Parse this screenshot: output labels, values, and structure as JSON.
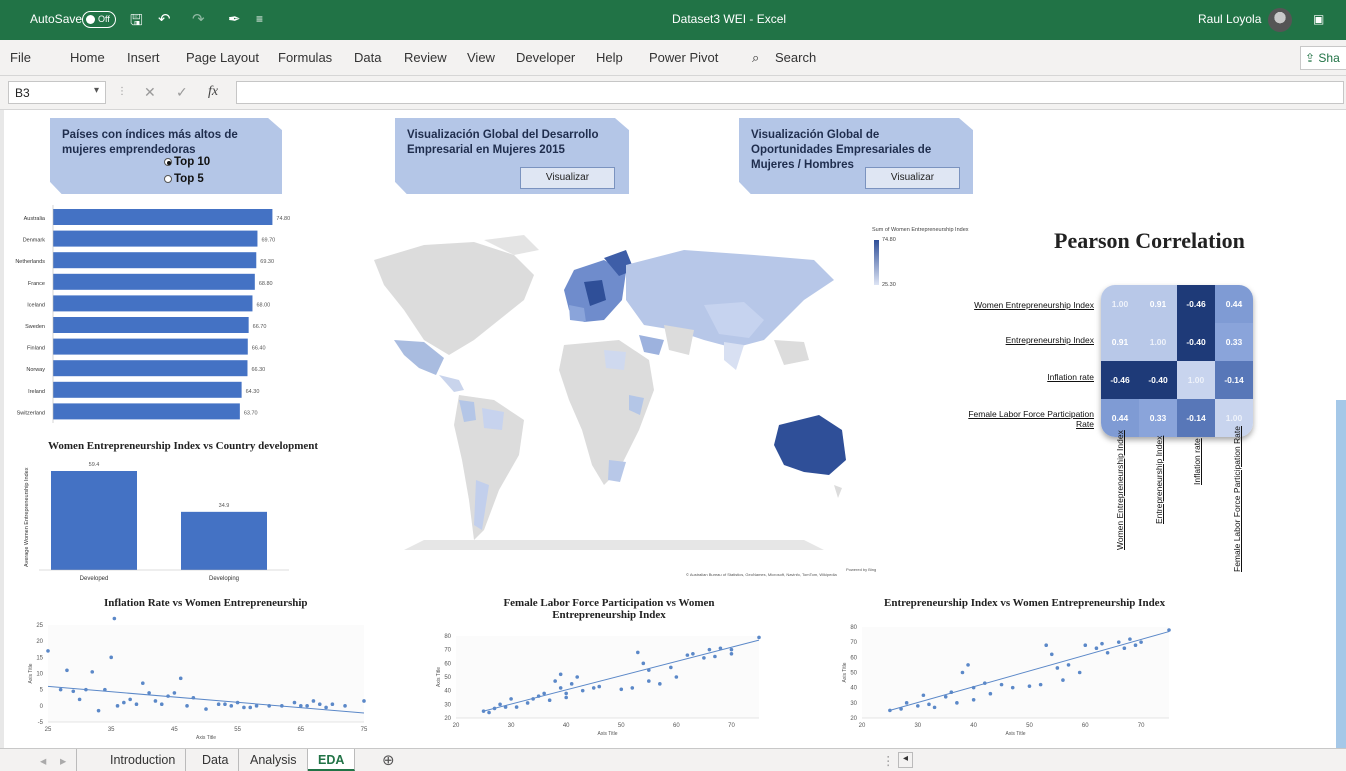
{
  "window": {
    "autosave_label": "AutoSave",
    "autosave_state": "Off",
    "title": "Dataset3 WEI  -  Excel",
    "user": "Raul Loyola"
  },
  "ribbon": {
    "tabs": [
      "File",
      "Home",
      "Insert",
      "Page Layout",
      "Formulas",
      "Data",
      "Review",
      "View",
      "Developer",
      "Help",
      "Power Pivot"
    ],
    "search": "Search",
    "share": "Sha"
  },
  "formula_bar": {
    "name_box": "B3",
    "fx": "fx",
    "formula": ""
  },
  "panels": {
    "top_countries_title": "Países con índices más altos de mujeres emprendedoras",
    "radio_top10": "Top 10",
    "radio_top5": "Top 5",
    "global_dev_title": "Visualización Global del Desarrollo Empresarial en Mujeres 2015",
    "global_opp_title": "Visualización Global de Oportunidades Empresariales de Mujeres / Hombres",
    "visualize_btn": "Visualizar"
  },
  "map": {
    "legend_title": "Sum of Women Entrepreneurship Index",
    "legend_max": "74.80",
    "legend_min": "25.30",
    "powered_by": "Powered by Bing",
    "credits": "© Australian Bureau of Statistics, GeoNames, Microsoft, Navinfo, TomTom, Wikipedia"
  },
  "correlation": {
    "title": "Pearson Correlation",
    "labels": [
      "Women Entrepreneurship Index",
      "Entrepreneurship Index",
      "Inflation rate",
      "Female Labor Force Participation Rate"
    ],
    "matrix": [
      [
        "1.00",
        "0.91",
        "-0.46",
        "0.44"
      ],
      [
        "0.91",
        "1.00",
        "-0.40",
        "0.33"
      ],
      [
        "-0.46",
        "-0.40",
        "1.00",
        "-0.14"
      ],
      [
        "0.44",
        "0.33",
        "-0.14",
        "1.00"
      ]
    ],
    "colors": [
      [
        "#b8c8e8",
        "#b8c8e8",
        "#1e3a78",
        "#7f9bd4"
      ],
      [
        "#b8c8e8",
        "#b8c8e8",
        "#1e3a78",
        "#8aa4da"
      ],
      [
        "#1e3a78",
        "#1e3a78",
        "#c8d4ee",
        "#5877b8"
      ],
      [
        "#7f9bd4",
        "#8aa4da",
        "#5877b8",
        "#c8d4ee"
      ]
    ]
  },
  "chart_data": [
    {
      "type": "bar",
      "orientation": "horizontal",
      "categories": [
        "Australia",
        "Denmark",
        "Netherlands",
        "France",
        "Iceland",
        "Sweden",
        "Finland",
        "Norway",
        "Ireland",
        "Switzerland"
      ],
      "values": [
        74.8,
        69.7,
        69.3,
        68.8,
        68.0,
        66.7,
        66.4,
        66.3,
        64.3,
        63.7
      ],
      "data_labels": [
        "74.80",
        "69.70",
        "69.30",
        "68.80",
        "68.00",
        "66.70",
        "66.40",
        "66.30",
        "64.30",
        "63.70"
      ],
      "color": "#4472c4"
    },
    {
      "type": "bar",
      "title": "Women Entrepreneurship Index vs Country development",
      "ylabel": "Average Women Entrepreneurship Index",
      "categories": [
        "Developed",
        "Developing"
      ],
      "values": [
        59.4,
        34.9
      ],
      "data_labels": [
        "59.4",
        "34.9"
      ],
      "color": "#4472c4"
    },
    {
      "type": "scatter",
      "title": "Inflation Rate vs Women Entrepreneurship",
      "xlabel": "Axis Title",
      "ylabel": "Axis Title",
      "xlim": [
        25,
        75
      ],
      "ylim": [
        -5,
        25
      ],
      "xticks": [
        25,
        35,
        45,
        55,
        65,
        75
      ],
      "yticks": [
        -5,
        0,
        5,
        10,
        15,
        20,
        25
      ],
      "trend": [
        [
          25,
          6.0
        ],
        [
          75,
          -2.2
        ]
      ],
      "points": [
        [
          25,
          17.0
        ],
        [
          27,
          5.0
        ],
        [
          28,
          11.0
        ],
        [
          29,
          4.5
        ],
        [
          30,
          2.0
        ],
        [
          31,
          5.0
        ],
        [
          32,
          10.5
        ],
        [
          33,
          -1.5
        ],
        [
          34,
          5.0
        ],
        [
          35,
          15.0
        ],
        [
          35.5,
          27.0
        ],
        [
          36,
          0
        ],
        [
          37,
          1.0
        ],
        [
          38,
          2.0
        ],
        [
          39,
          0.5
        ],
        [
          40,
          7.0
        ],
        [
          41,
          4.0
        ],
        [
          42,
          1.5
        ],
        [
          43,
          0.5
        ],
        [
          44,
          3.0
        ],
        [
          45,
          4.0
        ],
        [
          46,
          8.5
        ],
        [
          47,
          0
        ],
        [
          48,
          2.5
        ],
        [
          50,
          -1.0
        ],
        [
          52,
          0.5
        ],
        [
          53,
          0.5
        ],
        [
          54,
          0
        ],
        [
          55,
          1.0
        ],
        [
          56,
          -0.5
        ],
        [
          57,
          -0.5
        ],
        [
          58,
          0
        ],
        [
          60,
          0
        ],
        [
          62,
          0
        ],
        [
          64,
          1.0
        ],
        [
          65,
          0
        ],
        [
          66,
          0
        ],
        [
          67,
          1.5
        ],
        [
          68,
          0.5
        ],
        [
          69,
          -0.5
        ],
        [
          70,
          0.5
        ],
        [
          72,
          0
        ],
        [
          75,
          1.5
        ]
      ]
    },
    {
      "type": "scatter",
      "title": "Female Labor Force Participation vs Women Entrepreneurship Index",
      "xlabel": "Axis Title",
      "ylabel": "Axis Title",
      "xlim": [
        20,
        75
      ],
      "ylim": [
        20,
        80
      ],
      "xticks": [
        20,
        30,
        40,
        50,
        60,
        70
      ],
      "yticks": [
        20,
        30,
        40,
        50,
        60,
        70,
        80
      ],
      "trend": [
        [
          25,
          25
        ],
        [
          75,
          77
        ]
      ],
      "points": [
        [
          25,
          25
        ],
        [
          26,
          24
        ],
        [
          27,
          27
        ],
        [
          28,
          30
        ],
        [
          29,
          28
        ],
        [
          30,
          34
        ],
        [
          31,
          28
        ],
        [
          33,
          31
        ],
        [
          34,
          34
        ],
        [
          35,
          36
        ],
        [
          36,
          38
        ],
        [
          37,
          33
        ],
        [
          38,
          47
        ],
        [
          39,
          52
        ],
        [
          39,
          42
        ],
        [
          40,
          38
        ],
        [
          40,
          35
        ],
        [
          41,
          45
        ],
        [
          42,
          50
        ],
        [
          43,
          40
        ],
        [
          45,
          42
        ],
        [
          46,
          43
        ],
        [
          50,
          41
        ],
        [
          52,
          42
        ],
        [
          53,
          68
        ],
        [
          54,
          60
        ],
        [
          55,
          55
        ],
        [
          55,
          47
        ],
        [
          57,
          45
        ],
        [
          59,
          57
        ],
        [
          60,
          50
        ],
        [
          62,
          66
        ],
        [
          63,
          67
        ],
        [
          65,
          64
        ],
        [
          66,
          70
        ],
        [
          67,
          65
        ],
        [
          68,
          71
        ],
        [
          70,
          70
        ],
        [
          70,
          67
        ],
        [
          75,
          79
        ]
      ]
    },
    {
      "type": "scatter",
      "title": "Entrepreneurship Index vs Women Entrepreneurship Index",
      "xlabel": "Axis Title",
      "ylabel": "Axis Title",
      "xlim": [
        20,
        75
      ],
      "ylim": [
        20,
        80
      ],
      "xticks": [
        20,
        30,
        40,
        50,
        60,
        70
      ],
      "yticks": [
        20,
        30,
        40,
        50,
        60,
        70,
        80
      ],
      "trend": [
        [
          25,
          25
        ],
        [
          75,
          77
        ]
      ],
      "points": [
        [
          25,
          25
        ],
        [
          27,
          26
        ],
        [
          28,
          30
        ],
        [
          30,
          28
        ],
        [
          31,
          35
        ],
        [
          32,
          29
        ],
        [
          33,
          27
        ],
        [
          35,
          34
        ],
        [
          36,
          37
        ],
        [
          37,
          30
        ],
        [
          38,
          50
        ],
        [
          39,
          55
        ],
        [
          40,
          40
        ],
        [
          40,
          32
        ],
        [
          42,
          43
        ],
        [
          43,
          36
        ],
        [
          45,
          42
        ],
        [
          47,
          40
        ],
        [
          50,
          41
        ],
        [
          52,
          42
        ],
        [
          53,
          68
        ],
        [
          54,
          62
        ],
        [
          55,
          53
        ],
        [
          56,
          45
        ],
        [
          57,
          55
        ],
        [
          59,
          50
        ],
        [
          60,
          68
        ],
        [
          62,
          66
        ],
        [
          63,
          69
        ],
        [
          64,
          63
        ],
        [
          66,
          70
        ],
        [
          67,
          66
        ],
        [
          68,
          72
        ],
        [
          69,
          68
        ],
        [
          70,
          70
        ],
        [
          75,
          78
        ]
      ]
    }
  ],
  "sheet_tabs": [
    "Introduction",
    "Data",
    "Analysis",
    "EDA"
  ]
}
